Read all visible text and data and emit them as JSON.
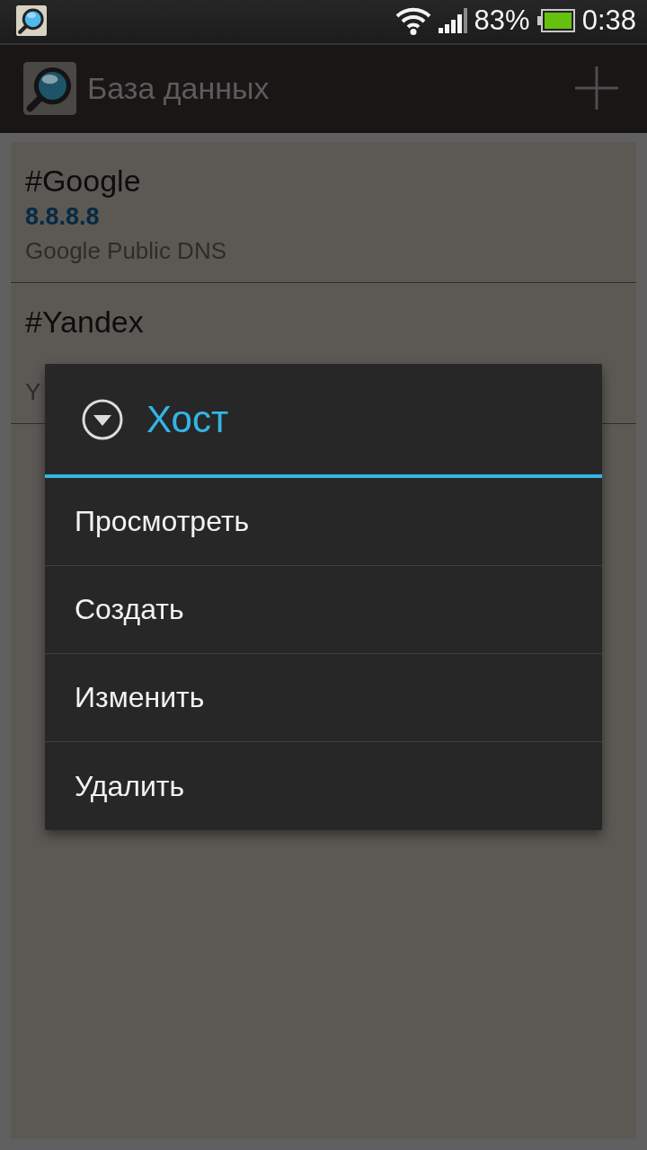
{
  "status_bar": {
    "battery": "83%",
    "time": "0:38"
  },
  "action_bar": {
    "title": "База данных"
  },
  "hosts": [
    {
      "name": "#Google",
      "address": "8.8.8.8",
      "description": "Google Public DNS"
    },
    {
      "name": "#Yandex",
      "description": "Y"
    }
  ],
  "dialog": {
    "title": "Хост",
    "items": [
      "Просмотреть",
      "Создать",
      "Изменить",
      "Удалить"
    ]
  }
}
